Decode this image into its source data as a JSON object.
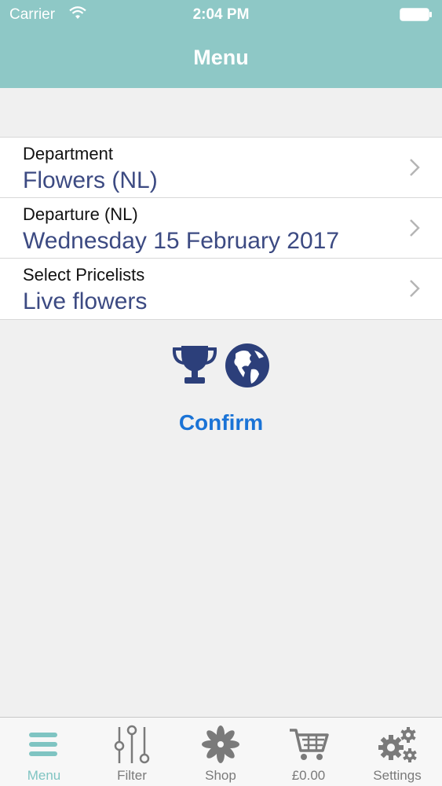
{
  "status": {
    "carrier": "Carrier",
    "time": "2:04 PM"
  },
  "nav": {
    "title": "Menu"
  },
  "rows": [
    {
      "label": "Department",
      "value": "Flowers (NL)"
    },
    {
      "label": "Departure (NL)",
      "value": "Wednesday 15 February 2017"
    },
    {
      "label": "Select Pricelists",
      "value": "Live flowers"
    }
  ],
  "icons": [
    "trophy-icon",
    "globe-icon"
  ],
  "actions": {
    "confirm": "Confirm"
  },
  "tabs": [
    {
      "label": "Menu",
      "icon": "menu-icon",
      "active": true
    },
    {
      "label": "Filter",
      "icon": "sliders-icon"
    },
    {
      "label": "Shop",
      "icon": "flower-icon"
    },
    {
      "label": "£0.00",
      "icon": "cart-icon"
    },
    {
      "label": "Settings",
      "icon": "gears-icon"
    }
  ],
  "colors": {
    "header": "#8ec8c6",
    "value_text": "#3c4a82",
    "accent": "#1a73d6",
    "tab_active": "#7fc4c2",
    "icon_dark": "#2c3f7a"
  }
}
